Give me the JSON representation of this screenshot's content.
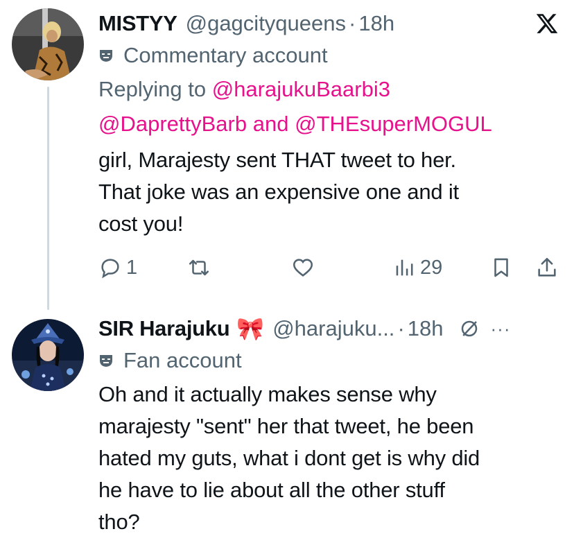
{
  "tweet1": {
    "display_name": "MISTYY",
    "handle": "@gagcityqueens",
    "separator": "·",
    "time": "18h",
    "account_label": "Commentary account",
    "replying_prefix": "Replying to",
    "reply_mention_1": "@harajukuBaarbi3",
    "reply_mention_2": "@DaprettyBarb",
    "reply_and": "and",
    "reply_mention_3": "@THEsuperMOGUL",
    "text_line_1": "girl, Marajesty sent THAT tweet to her.",
    "text_line_2": "That joke was an expensive one and it",
    "text_line_3": "cost you!",
    "reply_count": "1",
    "views_count": "29"
  },
  "tweet2": {
    "display_name": "SIR Harajuku",
    "emoji": "🎀",
    "handle": "@harajuku...",
    "separator": "·",
    "time": "18h",
    "more": "···",
    "account_label": "Fan account",
    "text_line_1": "Oh and it actually makes sense why",
    "text_line_2": "marajesty \"sent\" her that tweet, he been",
    "text_line_3": "hated my guts, what i dont get is why did",
    "text_line_4": "he have to lie about all the other stuff",
    "text_line_5": "tho?"
  },
  "colors": {
    "text": "#0f1419",
    "secondary": "#536471",
    "mention": "#e6128c",
    "thread_line": "#cfd9de"
  },
  "icons": [
    "x-logo-icon",
    "commentary-mask-icon",
    "reply-icon",
    "retweet-icon",
    "like-icon",
    "views-icon",
    "bookmark-icon",
    "share-icon",
    "fan-mask-icon",
    "ribbon-emoji",
    "not-interested-icon",
    "more-icon"
  ]
}
